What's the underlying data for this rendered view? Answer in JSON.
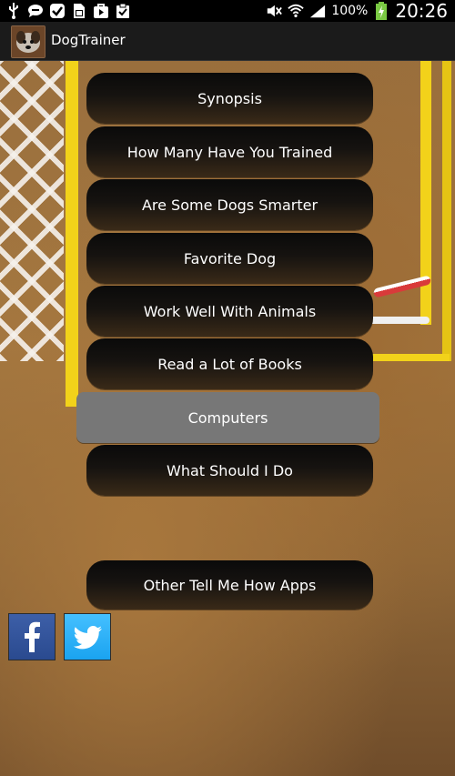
{
  "status_bar": {
    "battery_percent": "100%",
    "time": "20:26",
    "icons": [
      "usb-icon",
      "chat-icon",
      "check-icon",
      "sim-icon",
      "play-store-icon",
      "clipboard-check-icon",
      "mute-icon",
      "wifi-icon",
      "signal-icon",
      "battery-icon"
    ]
  },
  "app": {
    "title": "DogTrainer",
    "icon": "dog-face-icon"
  },
  "menu": {
    "items": [
      {
        "label": "Synopsis"
      },
      {
        "label": "How Many Have You Trained"
      },
      {
        "label": "Are Some Dogs Smarter"
      },
      {
        "label": "Favorite Dog"
      },
      {
        "label": "Work Well With Animals"
      },
      {
        "label": "Read a Lot of Books"
      },
      {
        "label": "Computers",
        "selected": true
      },
      {
        "label": "What Should I Do"
      }
    ],
    "other_apps_label": "Other Tell Me How Apps"
  },
  "social": {
    "facebook_icon": "facebook-icon",
    "twitter_icon": "twitter-icon"
  },
  "colors": {
    "button_dark": "#0a0a0a",
    "button_selected": "#777777",
    "facebook": "#3d5fa8",
    "twitter": "#1aa3f0",
    "battery": "#7ac943"
  }
}
